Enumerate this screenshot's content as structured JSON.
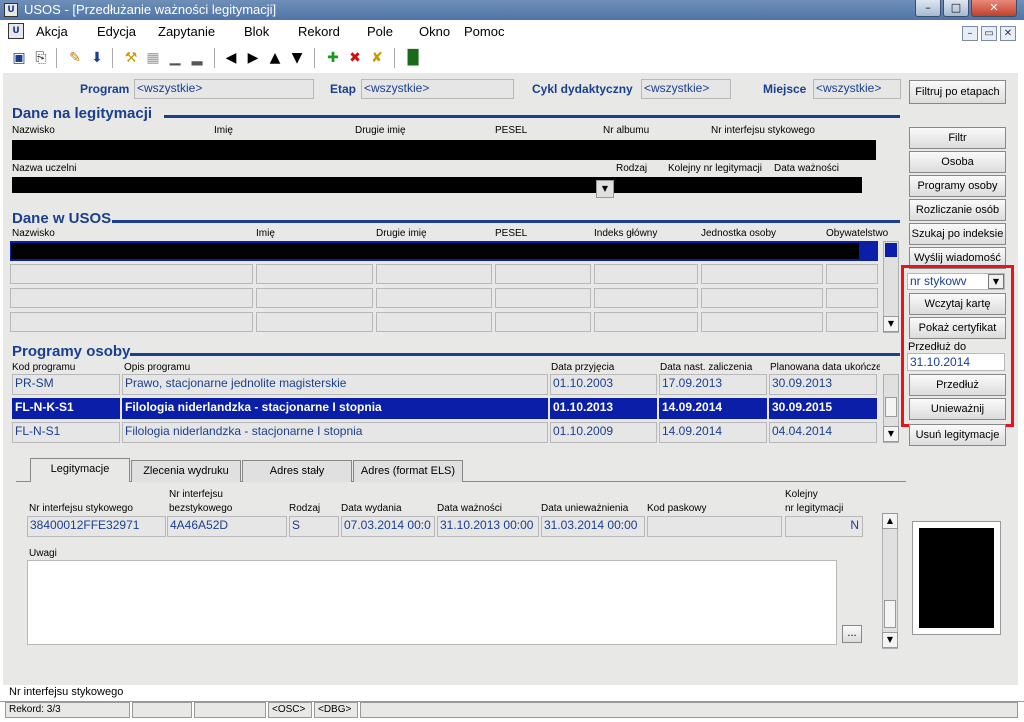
{
  "window": {
    "title": "USOS - [Przedłużanie ważności legitymacji]",
    "icon": "usos-icon"
  },
  "menu": [
    "Akcja",
    "Edycja",
    "Zapytanie",
    "Blok",
    "Rekord",
    "Pole",
    "Okno",
    "Pomoc"
  ],
  "filters": {
    "program_label": "Program",
    "program_value": "<wszystkie>",
    "etap_label": "Etap",
    "etap_value": "<wszystkie>",
    "cykl_label": "Cykl dydaktyczny",
    "cykl_value": "<wszystkie>",
    "miejsce_label": "Miejsce",
    "miejsce_value": "<wszystkie>",
    "filter_button": "Filtruj po etapach"
  },
  "legitymacja": {
    "title": "Dane na legitymacji",
    "columns": [
      "Nazwisko",
      "Imię",
      "Drugie imię",
      "PESEL",
      "Nr albumu",
      "Nr interfejsu stykowego"
    ],
    "columns2": [
      "Nazwa uczelni",
      "Rodzaj",
      "Kolejny nr legitymacji",
      "Data ważności"
    ]
  },
  "usos": {
    "title": "Dane w USOS",
    "columns": [
      "Nazwisko",
      "Imię",
      "Drugie imię",
      "PESEL",
      "Indeks główny",
      "Jednostka osoby",
      "Obywatelstwo"
    ]
  },
  "programy": {
    "title": "Programy osoby",
    "columns": [
      "Kod programu",
      "Opis programu",
      "Data przyjęcia",
      "Data nast. zaliczenia",
      "Planowana data ukończenia"
    ],
    "rows": [
      {
        "kod": "PR-SM",
        "opis": "Prawo, stacjonarne jednolite magisterskie",
        "przyjecie": "01.10.2003",
        "zaliczenie": "17.09.2013",
        "ukonczenie": "30.09.2013"
      },
      {
        "kod": "FL-N-K-S1",
        "opis": "Filologia niderlandzka - stacjonarne I stopnia",
        "przyjecie": "01.10.2013",
        "zaliczenie": "14.09.2014",
        "ukonczenie": "30.09.2015"
      },
      {
        "kod": "FL-N-S1",
        "opis": "Filologia niderlandzka - stacjonarne I stopnia",
        "przyjecie": "01.10.2009",
        "zaliczenie": "14.09.2014",
        "ukonczenie": "04.04.2014"
      }
    ]
  },
  "side_buttons": [
    "Filtr",
    "Osoba",
    "Programy osoby",
    "Rozliczanie osób",
    "Szukaj po indeksie",
    "Wyślij wiadomość"
  ],
  "card_panel": {
    "select_value": "nr stykowv",
    "load_button": "Wczytaj kartę",
    "cert_button": "Pokaż certyfikat",
    "extend_label": "Przedłuż do",
    "extend_value": "31.10.2014",
    "extend_button": "Przedłuż",
    "invalidate_button": "Unieważnij",
    "highlight_color": "#e8141c"
  },
  "remove_button": "Usuń legitymacje",
  "tabs": [
    "Legitymacje",
    "Zlecenia wydruku",
    "Adres stały",
    "Adres (format ELS)"
  ],
  "detail": {
    "h_interfejs": "Nr interfejsu stykowego",
    "h_bez1": "Nr interfejsu",
    "h_bez2": "bezstykowego",
    "h_rodzaj": "Rodzaj",
    "h_wydania": "Data wydania",
    "h_waznosci": "Data ważności",
    "h_uniewaz": "Data unieważnienia",
    "h_kod": "Kod paskowy",
    "h_kolejny1": "Kolejny",
    "h_kolejny2": "nr legitymacji",
    "v_interfejs": "38400012FFE32971",
    "v_bez": "4A46A52D",
    "v_rodzaj": "S",
    "v_wydania": "07.03.2014 00:0",
    "v_waznosci": "31.10.2013 00:00",
    "v_uniewaz": "31.03.2014 00:00",
    "v_kod": "",
    "v_kolejny": "N",
    "uwagi_label": "Uwagi",
    "ellipsis": "..."
  },
  "status": {
    "hint": "Nr interfejsu stykowego",
    "record": "Rekord: 3/3",
    "osc": "<OSC>",
    "dbg": "<DBG>"
  }
}
